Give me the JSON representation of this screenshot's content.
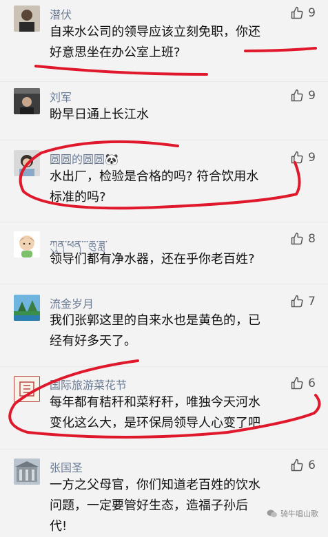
{
  "comments": [
    {
      "name": "潜伏",
      "likes": "9",
      "lines": [
        "自来水公司的领导应该立刻免职，你还",
        "好意思坐在办公室上班?"
      ]
    },
    {
      "name": "刘军",
      "likes": "9",
      "lines": [
        "盼早日通上长江水"
      ]
    },
    {
      "name": "圆圆的圆圆",
      "name_emoji": "🐼",
      "likes": "9",
      "lines": [
        "水出厂，检验是合格的吗? 符合饮用水",
        "标准的吗?"
      ]
    },
    {
      "name": "ཀུན་ཕན་་་ཆུ་ཟླ་",
      "likes": "8",
      "lines": [
        "领导们都有净水器，还在乎你老百姓?"
      ]
    },
    {
      "name": "流金岁月",
      "likes": "7",
      "lines": [
        "我们张郭这里的自来水也是黄色的，已",
        "经有好多天了。"
      ]
    },
    {
      "name": "国际旅游菜花节",
      "likes": "6",
      "lines": [
        "每年都有秸秆和菜籽秆，唯独今天河水",
        "变化这么大，是环保局领导人心变了吧"
      ]
    },
    {
      "name": "张国圣",
      "likes": "6",
      "lines": [
        "一方之父母官，你们知道老百姓的饮水",
        "问题，一定要管好生态，造福子孙后",
        "代!"
      ]
    }
  ],
  "watermark": "骑牛唱山歌",
  "colors": {
    "name": "#6b7b94",
    "annotation": "#e0182b"
  }
}
